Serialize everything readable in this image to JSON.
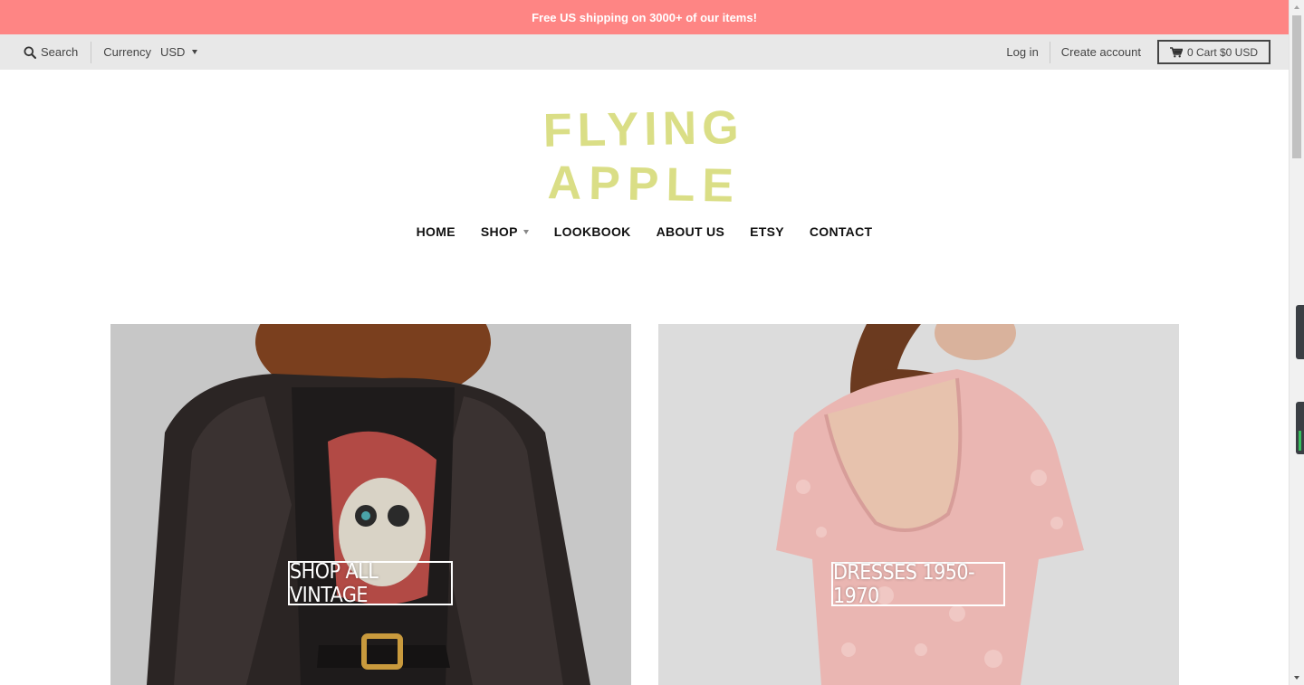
{
  "announcement": "Free US shipping on 3000+ of our items!",
  "topbar": {
    "search_label": "Search",
    "search_icon": "search-icon",
    "currency_label": "Currency",
    "currency_value": "USD",
    "login": "Log in",
    "create_account": "Create account",
    "cart_label": "0 Cart $0 USD",
    "cart_icon": "cart-icon"
  },
  "logo": {
    "line1": "FLYING",
    "line2": "APPLE",
    "color": "#dade86"
  },
  "nav": {
    "items": [
      {
        "label": "HOME"
      },
      {
        "label": "SHOP",
        "has_dropdown": true
      },
      {
        "label": "LOOKBOOK"
      },
      {
        "label": "ABOUT US"
      },
      {
        "label": "ETSY"
      },
      {
        "label": "CONTACT"
      }
    ]
  },
  "tiles": [
    {
      "label": "SHOP ALL VINTAGE"
    },
    {
      "label": "DRESSES 1950-1970"
    }
  ],
  "colors": {
    "announcement_bg": "#fe8584",
    "topbar_bg": "#e8e8e8",
    "accent": "#dade86"
  }
}
